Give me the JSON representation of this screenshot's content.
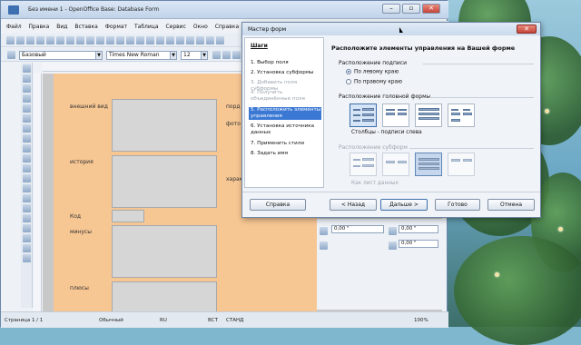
{
  "window": {
    "title": "Без имени 1 - OpenOffice Base: Database Form"
  },
  "menu": [
    "Файл",
    "Правка",
    "Вид",
    "Вставка",
    "Формат",
    "Таблица",
    "Сервис",
    "Окно",
    "Справка"
  ],
  "format_bar": {
    "style": "Базовый",
    "font": "Times New Roman",
    "size": "12"
  },
  "form_labels": {
    "appearance": "внешний вид",
    "history": "история",
    "code": "Код",
    "minuses": "минусы",
    "pluses": "плюсы",
    "right1": "порд",
    "right2": "фото",
    "right3": "характ"
  },
  "side_panel": {
    "spin1": "0,00 \"",
    "spin2": "0,00 \"",
    "spin3": "0,00 \"",
    "spin4": "0,00 \""
  },
  "status": {
    "page": "Страница 1 / 1",
    "style": "Обычный",
    "lang": "RU",
    "mode": "ВСТ",
    "std": "СТАНД",
    "zoom": "100%"
  },
  "dialog": {
    "title": "Мастер форм",
    "steps_heading": "Шаги",
    "steps": [
      {
        "label": "1. Выбор поля",
        "state": "normal"
      },
      {
        "label": "2. Установка субформы",
        "state": "normal"
      },
      {
        "label": "3. Добавить поля субформы",
        "state": "disabled"
      },
      {
        "label": "4. Получить объединённые поля",
        "state": "disabled"
      },
      {
        "label": "5. Расположить элементы управления",
        "state": "current"
      },
      {
        "label": "6. Установка источника данных",
        "state": "normal"
      },
      {
        "label": "7. Применить стили",
        "state": "normal"
      },
      {
        "label": "8. Задать имя",
        "state": "normal"
      }
    ],
    "heading": "Расположите элементы управления на Вашей форме",
    "labels_section": "Расположение подписи",
    "radio_left": "По левому краю",
    "radio_right": "По правому краю",
    "main_layout_section": "Расположение головной формы",
    "main_layout_caption": "Столбцы - подписи слева",
    "sub_layout_section": "Расположение субформ",
    "sub_layout_caption": "Как лист данных",
    "buttons": {
      "help": "Справка",
      "back": "< Назад",
      "next": "Дальше >",
      "done": "Готово",
      "cancel": "Отмена"
    }
  }
}
